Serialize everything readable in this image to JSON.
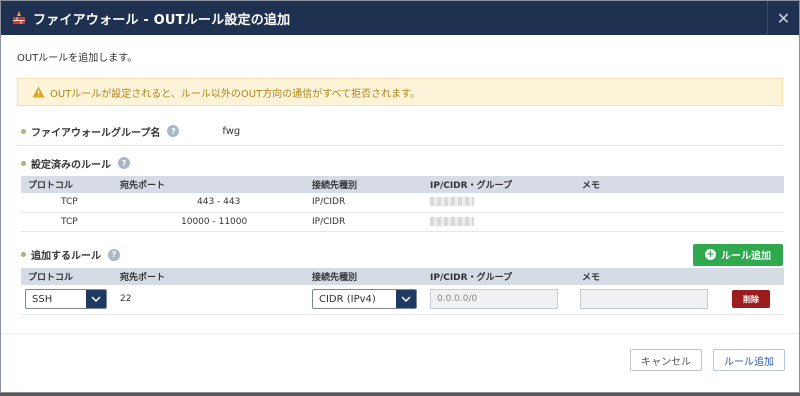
{
  "dialog": {
    "title": "ファイアウォール - OUTルール設定の追加",
    "close": "✕"
  },
  "intro": "OUTルールを追加します。",
  "warning": "OUTルールが設定されると、ルール以外のOUT方向の通信がすべて拒否されます。",
  "firewall_group": {
    "label": "ファイアウォールグループ名",
    "value": "fwg"
  },
  "existing_rules": {
    "label": "設定済みのルール",
    "columns": [
      "プロトコル",
      "宛先ポート",
      "接続先種別",
      "IP/CIDR・グループ",
      "メモ"
    ],
    "rows": [
      {
        "protocol": "TCP",
        "port": "443 - 443",
        "type": "IP/CIDR",
        "ip": "",
        "memo": ""
      },
      {
        "protocol": "TCP",
        "port": "10000 - 11000",
        "type": "IP/CIDR",
        "ip": "",
        "memo": ""
      }
    ]
  },
  "new_rules": {
    "label": "追加するルール",
    "add_rule_button": "ルール追加",
    "columns": [
      "プロトコル",
      "宛先ポート",
      "接続先種別",
      "IP/CIDR・グループ",
      "メモ"
    ],
    "row": {
      "protocol": "SSH",
      "port": "22",
      "type": "CIDR (IPv4)",
      "ip_placeholder": "0.0.0.0/0",
      "memo": "",
      "delete": "削除"
    }
  },
  "footer": {
    "cancel": "キャンセル",
    "submit": "ルール追加"
  },
  "colors": {
    "title_bar": "#1f3151",
    "warning_bg": "#fcf3d9",
    "warning_text": "#b0861a",
    "add_button": "#2fa84f",
    "delete_button": "#9b1c1c",
    "table_header": "#d5dce6"
  },
  "icons": {
    "title": "firewall-icon",
    "warning": "warning-triangle-icon",
    "help": "question-circle-icon",
    "add": "plus-circle-icon",
    "dropdown": "chevron-down-icon"
  }
}
